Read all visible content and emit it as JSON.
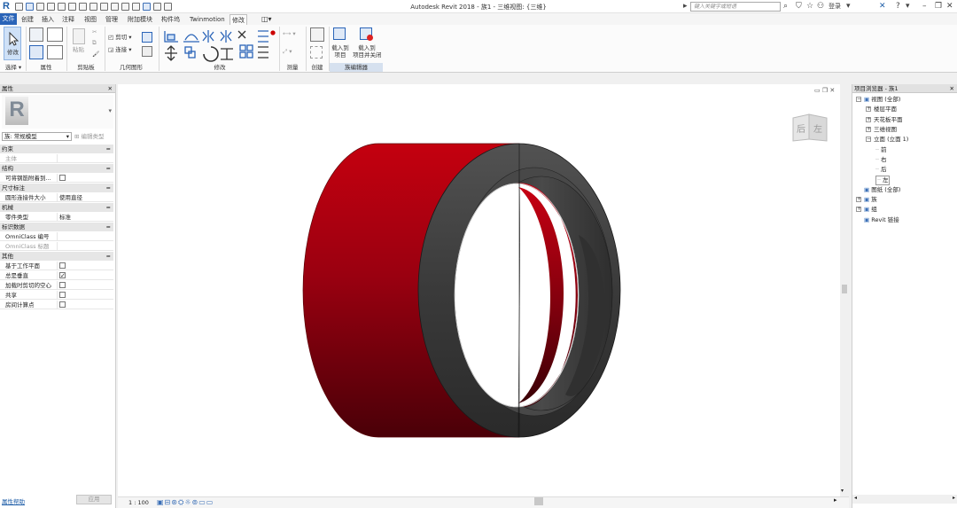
{
  "window": {
    "title": "Autodesk Revit 2018 -   族1 - 三维视图: {三维}",
    "search_placeholder": "键入关键字或短语",
    "login": "登录"
  },
  "tabs": [
    "文件",
    "创建",
    "插入",
    "注释",
    "视图",
    "管理",
    "附加模块",
    "构件坞",
    "Twinmotion",
    "修改"
  ],
  "active_tab": "修改",
  "ribbon": {
    "select_label": "选择",
    "modify_label": "修改",
    "panels": [
      "属性",
      "剪贴板",
      "几何图形",
      "修改",
      "测量",
      "创建",
      "族编辑器"
    ],
    "clipboard": {
      "paste": "粘贴"
    },
    "geometry": {
      "cut": "剪切",
      "join": "连接"
    },
    "family_editor": {
      "load_to_project": "载入到\n项目",
      "load_and_close": "载入到\n项目并关闭"
    }
  },
  "properties": {
    "title": "属性",
    "type_selector": "族: 常规模型",
    "edit_type": "编辑类型",
    "groups": [
      {
        "name": "约束",
        "rows": [
          {
            "key": "主体",
            "value": "",
            "greyed": true
          }
        ]
      },
      {
        "name": "结构",
        "rows": [
          {
            "key": "可将钢筋附着到...",
            "value": "",
            "checkbox": true,
            "checked": false
          }
        ]
      },
      {
        "name": "尺寸标注",
        "rows": [
          {
            "key": "圆形连接件大小",
            "value": "使用直径"
          }
        ]
      },
      {
        "name": "机械",
        "rows": [
          {
            "key": "零件类型",
            "value": "标准"
          }
        ]
      },
      {
        "name": "标识数据",
        "rows": [
          {
            "key": "OmniClass 编号",
            "value": ""
          },
          {
            "key": "OmniClass 标题",
            "value": "",
            "greyed": true
          }
        ]
      },
      {
        "name": "其他",
        "rows": [
          {
            "key": "基于工作平面",
            "value": "",
            "checkbox": true,
            "checked": false
          },
          {
            "key": "总是垂直",
            "value": "",
            "checkbox": true,
            "checked": true
          },
          {
            "key": "加载时剪切的空心",
            "value": "",
            "checkbox": true,
            "checked": false
          },
          {
            "key": "共享",
            "value": "",
            "checkbox": true,
            "checked": false
          },
          {
            "key": "房间计算点",
            "value": "",
            "checkbox": true,
            "checked": false
          }
        ]
      }
    ],
    "help_link": "属性帮助",
    "apply_button": "应用"
  },
  "viewport": {
    "viewcube": {
      "face_left": "后",
      "face_right": "左"
    },
    "scale": "1 : 100",
    "model_colors": {
      "outer_shell": "#b00010",
      "inner_shell": "#8f0010",
      "ring": "#3a3a3a"
    }
  },
  "browser": {
    "title": "项目浏览器 - 族1",
    "tree": [
      {
        "label": "视图 (全部)",
        "level": 0,
        "expanded": true
      },
      {
        "label": "楼层平面",
        "level": 1,
        "expanded": false
      },
      {
        "label": "天花板平面",
        "level": 1,
        "expanded": false
      },
      {
        "label": "三维视图",
        "level": 1,
        "expanded": false
      },
      {
        "label": "立面 (立面 1)",
        "level": 1,
        "expanded": true
      },
      {
        "label": "前",
        "level": 2
      },
      {
        "label": "右",
        "level": 2
      },
      {
        "label": "后",
        "level": 2
      },
      {
        "label": "左",
        "level": 2,
        "selected": true
      },
      {
        "label": "图纸 (全部)",
        "level": 0
      },
      {
        "label": "族",
        "level": 0,
        "expanded": false
      },
      {
        "label": "组",
        "level": 0,
        "expanded": false
      },
      {
        "label": "Revit 链接",
        "level": 0
      }
    ]
  }
}
